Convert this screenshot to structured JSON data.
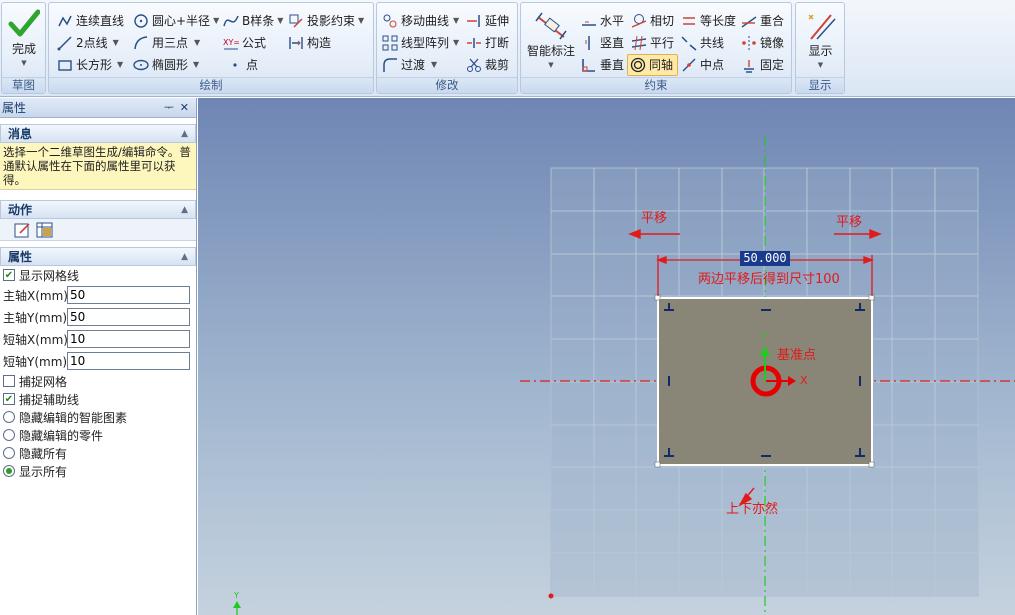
{
  "ribbon": {
    "groups": {
      "sketch": "草图",
      "draw": "绘制",
      "modify": "修改",
      "constraint": "约束",
      "display": "显示"
    },
    "finish": "完成",
    "draw_items": [
      "连续直线",
      "圆心+半径",
      "B样条",
      "投影约束",
      "2点线",
      "用三点",
      "公式",
      "构造",
      "长方形",
      "椭圆形",
      "点"
    ],
    "modify_items": [
      "移动曲线",
      "延伸",
      "线型阵列",
      "打断",
      "过渡",
      "裁剪"
    ],
    "smart_dim": "智能标注",
    "constraint_items": [
      "水平",
      "相切",
      "等长度",
      "重合",
      "竖直",
      "平行",
      "共线",
      "镜像",
      "垂直",
      "同轴",
      "中点",
      "固定"
    ],
    "display_btn": "显示"
  },
  "panel": {
    "title": "属性",
    "pin": "ᅮ",
    "close": "✕",
    "msg_header": "消息",
    "msg_text": "选择一个二维草图生成/编辑命令。普通默认属性在下面的属性里可以获得。",
    "action_header": "动作",
    "prop_header": "属性",
    "show_grid": "显示网格线",
    "fields": [
      {
        "label": "主轴X(mm)",
        "value": "50"
      },
      {
        "label": "主轴Y(mm)",
        "value": "50"
      },
      {
        "label": "短轴X(mm)",
        "value": "10"
      },
      {
        "label": "短轴Y(mm)",
        "value": "10"
      }
    ],
    "snap_grid": "捕捉网格",
    "snap_aux": "捕捉辅助线",
    "hide_smart": "隐藏编辑的智能图素",
    "hide_parts": "隐藏编辑的零件",
    "hide_all": "隐藏所有",
    "show_all": "显示所有"
  },
  "canvas": {
    "dimension": "50.000",
    "note_top": "两边平移后得到尺寸100",
    "pan_left": "平移",
    "pan_right": "平移",
    "base_point": "基准点",
    "note_bottom": "上下亦然",
    "axis_x": "X",
    "axis_y": "Y",
    "corner_y": "Y"
  },
  "colors": {
    "annotation": "#e11a1a",
    "rect_fill": "#8a8677",
    "axis": "#23c823"
  }
}
